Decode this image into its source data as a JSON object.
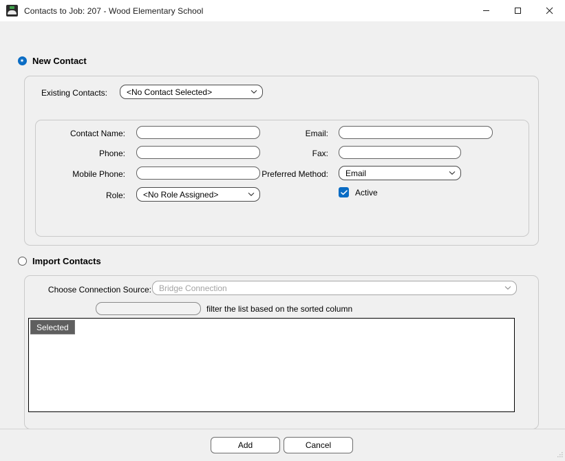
{
  "window": {
    "title": "Contacts to Job: 207 - Wood Elementary School",
    "icon": "app-icon",
    "minimize_label": "—",
    "maximize_label": "☐",
    "close_label": "✕"
  },
  "new_contact": {
    "radio_label": "New Contact",
    "selected": true,
    "existing_contacts": {
      "label": "Existing Contacts:",
      "value": "<No Contact Selected>"
    },
    "fields": {
      "contact_name": {
        "label": "Contact Name:",
        "value": "",
        "placeholder": ""
      },
      "phone": {
        "label": "Phone:",
        "value": "",
        "placeholder": ""
      },
      "mobile_phone": {
        "label": "Mobile Phone:",
        "value": "",
        "placeholder": ""
      },
      "role": {
        "label": "Role:",
        "value": "<No Role Assigned>"
      },
      "email": {
        "label": "Email:",
        "value": "",
        "placeholder": ""
      },
      "fax": {
        "label": "Fax:",
        "value": "",
        "placeholder": ""
      },
      "preferred_method": {
        "label": "Preferred Method:",
        "value": "Email"
      },
      "active": {
        "label": "Active",
        "checked": true
      }
    }
  },
  "import_contacts": {
    "radio_label": "Import Contacts",
    "selected": false,
    "connection_source": {
      "label": "Choose Connection Source:",
      "value": "Bridge Connection",
      "disabled": true
    },
    "filter": {
      "value": "",
      "hint": "filter the list based on the sorted column"
    },
    "list": {
      "columns": [
        "Selected"
      ],
      "rows": []
    }
  },
  "footer": {
    "add_label": "Add",
    "cancel_label": "Cancel"
  },
  "colors": {
    "accent": "#0a6cc4",
    "window_bg": "#f0f0f0",
    "header_bg": "#5f5f5f",
    "titlebar_bg": "#ffffff"
  }
}
